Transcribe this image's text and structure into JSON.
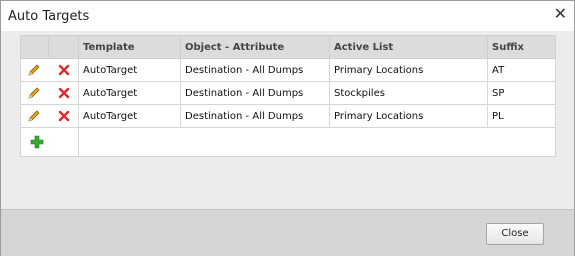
{
  "dialog": {
    "title": "Auto Targets",
    "close_glyph": "✕"
  },
  "table": {
    "columns": [
      "Template",
      "Object - Attribute",
      "Active List",
      "Suffix"
    ],
    "rows": [
      {
        "template": "AutoTarget",
        "object_attribute": "Destination - All Dumps",
        "active_list": "Primary Locations",
        "suffix": "AT"
      },
      {
        "template": "AutoTarget",
        "object_attribute": "Destination - All Dumps",
        "active_list": "Stockpiles",
        "suffix": "SP"
      },
      {
        "template": "AutoTarget",
        "object_attribute": "Destination - All Dumps",
        "active_list": "Primary Locations",
        "suffix": "PL"
      }
    ],
    "row_icons": {
      "edit": "pencil-icon",
      "delete": "red-x-icon"
    },
    "add_icon": "green-plus-icon"
  },
  "footer": {
    "close_label": "Close"
  },
  "colors": {
    "delete": "#e02b2b",
    "add": "#3aa833",
    "pencil": "#e0a21a"
  }
}
